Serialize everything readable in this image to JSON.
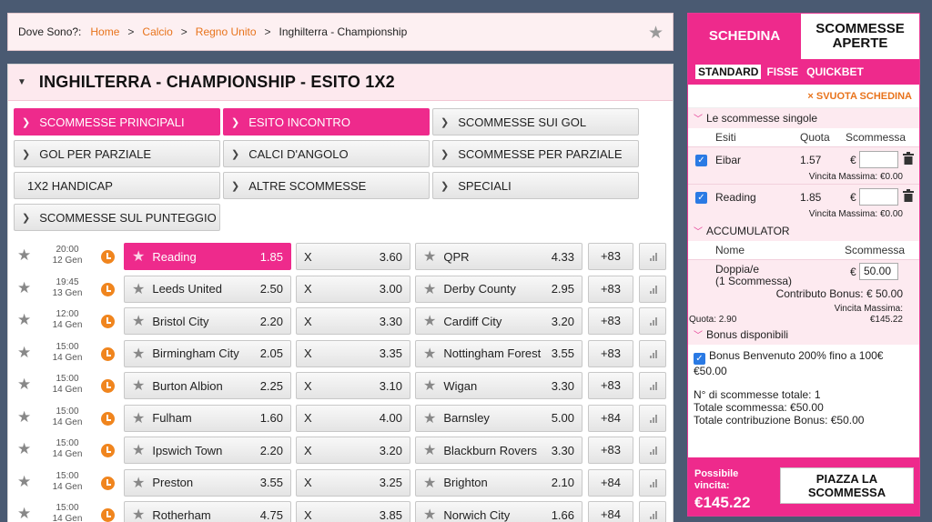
{
  "breadcrumb": {
    "label": "Dove Sono?:",
    "items": [
      "Home",
      "Calcio",
      "Regno Unito"
    ],
    "current": "Inghilterra - Championship"
  },
  "main": {
    "title": "INGHILTERRA - CHAMPIONSHIP - ESITO 1X2",
    "markets": [
      {
        "label": "SCOMMESSE PRINCIPALI",
        "active": true
      },
      {
        "label": "ESITO INCONTRO",
        "active": true
      },
      {
        "label": "SCOMMESSE SUI GOL",
        "active": false
      },
      {
        "label": "GOL PER PARZIALE",
        "active": false
      },
      {
        "label": "CALCI D'ANGOLO",
        "active": false
      },
      {
        "label": "SCOMMESSE PER PARZIALE",
        "active": false
      },
      {
        "label": "1X2 HANDICAP",
        "active": false
      },
      {
        "label": "ALTRE SCOMMESSE",
        "active": false
      },
      {
        "label": "SPECIALI",
        "active": false
      },
      {
        "label": "SCOMMESSE SUL PUNTEGGIO",
        "active": false
      }
    ],
    "events": [
      {
        "time": "20:00",
        "date": "12 Gen",
        "home": "Reading",
        "home_odds": "1.85",
        "draw_label": "X",
        "draw_odds": "3.60",
        "away": "QPR",
        "away_odds": "4.33",
        "more": "+83",
        "selected": true
      },
      {
        "time": "19:45",
        "date": "13 Gen",
        "home": "Leeds United",
        "home_odds": "2.50",
        "draw_label": "X",
        "draw_odds": "3.00",
        "away": "Derby County",
        "away_odds": "2.95",
        "more": "+83",
        "selected": false
      },
      {
        "time": "12:00",
        "date": "14 Gen",
        "home": "Bristol City",
        "home_odds": "2.20",
        "draw_label": "X",
        "draw_odds": "3.30",
        "away": "Cardiff City",
        "away_odds": "3.20",
        "more": "+83",
        "selected": false
      },
      {
        "time": "15:00",
        "date": "14 Gen",
        "home": "Birmingham City",
        "home_odds": "2.05",
        "draw_label": "X",
        "draw_odds": "3.35",
        "away": "Nottingham Forest",
        "away_odds": "3.55",
        "more": "+83",
        "selected": false
      },
      {
        "time": "15:00",
        "date": "14 Gen",
        "home": "Burton Albion",
        "home_odds": "2.25",
        "draw_label": "X",
        "draw_odds": "3.10",
        "away": "Wigan",
        "away_odds": "3.30",
        "more": "+83",
        "selected": false
      },
      {
        "time": "15:00",
        "date": "14 Gen",
        "home": "Fulham",
        "home_odds": "1.60",
        "draw_label": "X",
        "draw_odds": "4.00",
        "away": "Barnsley",
        "away_odds": "5.00",
        "more": "+84",
        "selected": false
      },
      {
        "time": "15:00",
        "date": "14 Gen",
        "home": "Ipswich Town",
        "home_odds": "2.20",
        "draw_label": "X",
        "draw_odds": "3.20",
        "away": "Blackburn Rovers",
        "away_odds": "3.30",
        "more": "+83",
        "selected": false
      },
      {
        "time": "15:00",
        "date": "14 Gen",
        "home": "Preston",
        "home_odds": "3.55",
        "draw_label": "X",
        "draw_odds": "3.25",
        "away": "Brighton",
        "away_odds": "2.10",
        "more": "+84",
        "selected": false
      },
      {
        "time": "15:00",
        "date": "14 Gen",
        "home": "Rotherham",
        "home_odds": "4.75",
        "draw_label": "X",
        "draw_odds": "3.85",
        "away": "Norwich City",
        "away_odds": "1.66",
        "more": "+84",
        "selected": false
      }
    ]
  },
  "slip": {
    "tab_slip": "SCHEDINA",
    "tab_open": "SCOMMESSE APERTE",
    "modes": [
      "STANDARD",
      "FISSE",
      "QUICKBET"
    ],
    "clear": "SVUOTA SCHEDINA",
    "singles_title": "Le scommesse singole",
    "col_esiti": "Esiti",
    "col_quota": "Quota",
    "col_scommessa": "Scommessa",
    "bets": [
      {
        "name": "Eibar",
        "odds": "1.57",
        "currency": "€",
        "max": "Vincita Massima: €0.00"
      },
      {
        "name": "Reading",
        "odds": "1.85",
        "currency": "€",
        "max": "Vincita Massima: €0.00"
      }
    ],
    "acc_title": "ACCUMULATOR",
    "acc_col_nome": "Nome",
    "acc_col_scommessa": "Scommessa",
    "acc_name": "Doppia/e",
    "acc_count": "(1 Scommessa)",
    "acc_currency": "€",
    "acc_stake": "50.00",
    "acc_bonus": "Contributo Bonus: € 50.00",
    "acc_max_label": "Vincita Massima:",
    "acc_max_value": "€145.22",
    "acc_quota": "Quota: 2.90",
    "bonus_title": "Bonus disponibili",
    "bonus_text": "Bonus Benvenuto 200% fino a 100€",
    "bonus_amount": "€50.00",
    "summary_count": "N° di scommesse totale: 1",
    "summary_total": "Totale scommessa: €50.00",
    "summary_bonus": "Totale contribuzione Bonus: €50.00",
    "possible_label": "Possibile vincita:",
    "possible_value": "€145.22",
    "place_button": "PIAZZA LA SCOMMESSA"
  }
}
